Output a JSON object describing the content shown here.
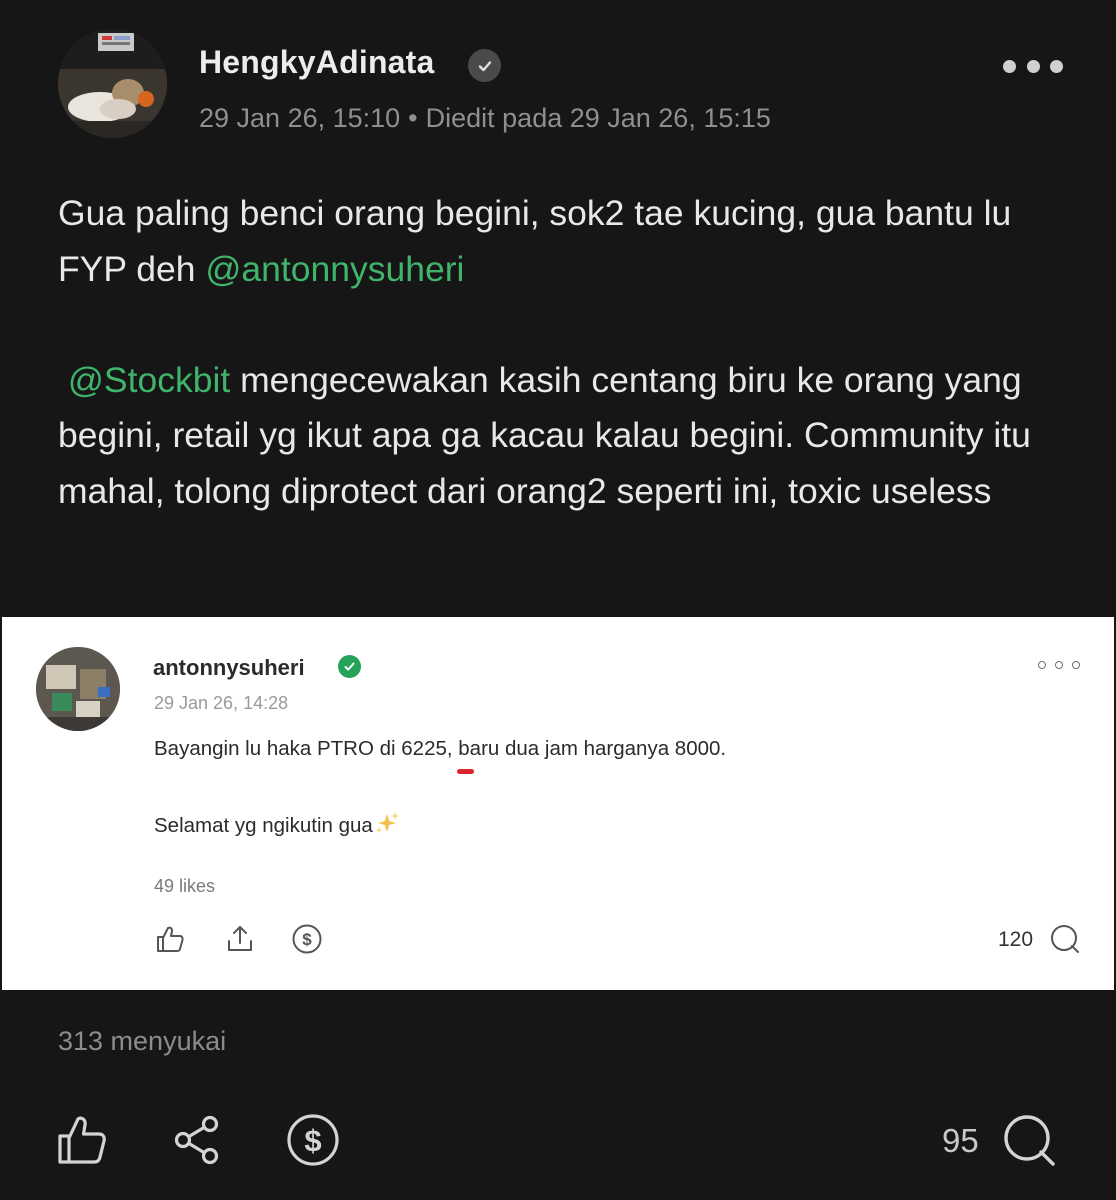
{
  "post": {
    "author": "HengkyAdinata",
    "posted_at": "29 Jan 26, 15:10",
    "edited_label": "Diedit pada 29 Jan 26, 15:15",
    "text_part1": "Gua paling benci orang begini, sok2 tae kucing, gua bantu lu FYP deh ",
    "mention1": "@antonnysuheri",
    "mention2": "@Stockbit",
    "text_part2": " mengecewakan kasih centang biru ke orang yang begini, retail yg ikut apa ga kacau kalau begini. Community itu mahal, tolong diprotect dari orang2 seperti ini, toxic useless",
    "likes_label": "313 menyukai",
    "comment_count": "95"
  },
  "embedded": {
    "author": "antonnysuheri",
    "posted_at": "29 Jan 26, 14:28",
    "line1": "Bayangin lu haka PTRO di 6225, baru dua jam harganya 8000.",
    "line2": "Selamat yg ngikutin gua",
    "likes_label": "49 likes",
    "comment_count": "120"
  },
  "colors": {
    "background": "#161616",
    "mention": "#3fb46a",
    "verified_green": "#25a35a",
    "highlight_red": "#e0242c"
  },
  "icons": [
    "verified-icon",
    "more-icon",
    "like-icon",
    "share-icon",
    "tip-dollar-icon",
    "comment-icon",
    "upload-icon",
    "sparkle-icon"
  ]
}
